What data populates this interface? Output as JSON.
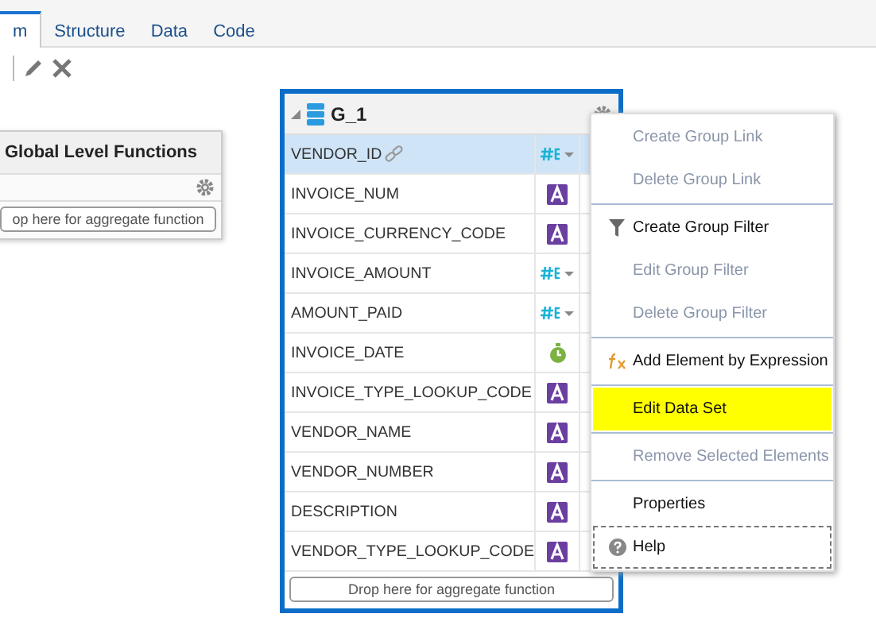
{
  "tabs": [
    {
      "label": "m",
      "selected": true
    },
    {
      "label": "Structure",
      "selected": false
    },
    {
      "label": "Data",
      "selected": false
    },
    {
      "label": "Code",
      "selected": false
    }
  ],
  "global_functions": {
    "title": "Global Level Functions",
    "drop_hint": "op here for aggregate function"
  },
  "group": {
    "title": "G_1",
    "drop_hint": "Drop here for aggregate function",
    "elements": [
      {
        "name": "VENDOR_ID",
        "kind": "number",
        "selected": true,
        "linked": true
      },
      {
        "name": "INVOICE_NUM",
        "kind": "text",
        "selected": false,
        "linked": false
      },
      {
        "name": "INVOICE_CURRENCY_CODE",
        "kind": "text",
        "selected": false,
        "linked": false
      },
      {
        "name": "INVOICE_AMOUNT",
        "kind": "number",
        "selected": false,
        "linked": false
      },
      {
        "name": "AMOUNT_PAID",
        "kind": "number",
        "selected": false,
        "linked": false
      },
      {
        "name": "INVOICE_DATE",
        "kind": "date",
        "selected": false,
        "linked": false
      },
      {
        "name": "INVOICE_TYPE_LOOKUP_CODE",
        "kind": "text",
        "selected": false,
        "linked": false
      },
      {
        "name": "VENDOR_NAME",
        "kind": "text",
        "selected": false,
        "linked": false
      },
      {
        "name": "VENDOR_NUMBER",
        "kind": "text",
        "selected": false,
        "linked": false
      },
      {
        "name": "DESCRIPTION",
        "kind": "text",
        "selected": false,
        "linked": false
      },
      {
        "name": "VENDOR_TYPE_LOOKUP_CODE",
        "kind": "text",
        "selected": false,
        "linked": false
      }
    ]
  },
  "context_menu": {
    "sections": [
      [
        {
          "label": "Create Group Link",
          "kind": "plain",
          "disabled": true,
          "highlighted": false,
          "focused": false
        },
        {
          "label": "Delete Group Link",
          "kind": "plain",
          "disabled": true,
          "highlighted": false,
          "focused": false
        }
      ],
      [
        {
          "label": "Create Group Filter",
          "kind": "filter",
          "disabled": false,
          "highlighted": false,
          "focused": false
        },
        {
          "label": "Edit Group Filter",
          "kind": "plain",
          "disabled": true,
          "highlighted": false,
          "focused": false
        },
        {
          "label": "Delete Group Filter",
          "kind": "plain",
          "disabled": true,
          "highlighted": false,
          "focused": false
        }
      ],
      [
        {
          "label": "Add Element by Expression",
          "kind": "expression",
          "disabled": false,
          "highlighted": false,
          "focused": false
        }
      ],
      [
        {
          "label": "Edit Data Set",
          "kind": "plain",
          "disabled": false,
          "highlighted": true,
          "focused": false
        }
      ],
      [
        {
          "label": "Remove Selected Elements",
          "kind": "plain",
          "disabled": true,
          "highlighted": false,
          "focused": false
        }
      ],
      [
        {
          "label": "Properties",
          "kind": "plain",
          "disabled": false,
          "highlighted": false,
          "focused": false
        },
        {
          "label": "Help",
          "kind": "help",
          "disabled": false,
          "highlighted": false,
          "focused": true
        }
      ]
    ]
  }
}
